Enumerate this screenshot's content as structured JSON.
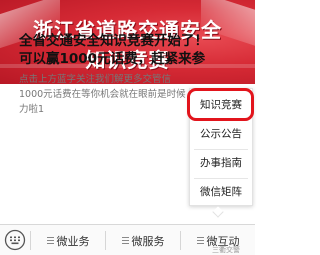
{
  "banner": {
    "title_line1": "浙江省道路交通安全",
    "title_line2": "知识竞赛"
  },
  "article": {
    "headline_line1": "全省交通安全知识竞赛开始了！",
    "headline_line2": "可以赢1000元话费，赶紧来参",
    "body_line1": "点击上方蓝字关注我们解更多交管信",
    "body_line2": "1000元话费在等你机会就在眼前是时候",
    "body_line3": "力啦1"
  },
  "popup_menu": {
    "items": [
      {
        "label": "知识竞赛",
        "highlighted": true
      },
      {
        "label": "公示公告",
        "highlighted": false
      },
      {
        "label": "办事指南",
        "highlighted": false
      },
      {
        "label": "微信矩阵",
        "highlighted": false
      }
    ]
  },
  "bottom_nav": {
    "items": [
      {
        "label": "微业务"
      },
      {
        "label": "微服务"
      },
      {
        "label": "微互动"
      }
    ]
  },
  "watermark": "三衢交警",
  "colors": {
    "banner_red": "#d62a35",
    "highlight_red": "#e2141c"
  }
}
